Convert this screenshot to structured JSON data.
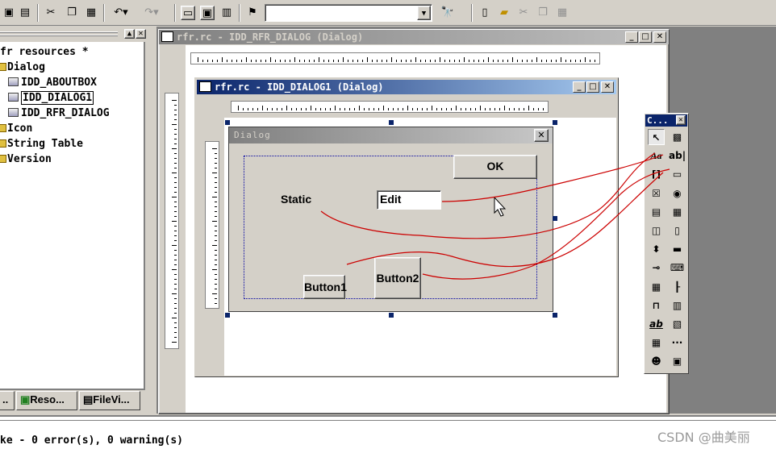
{
  "toolbar": {
    "icons": [
      "save-all-icon",
      "save-icon",
      "cut-icon",
      "copy-icon",
      "paste-icon",
      "undo-icon",
      "redo-icon",
      "workspace-icon",
      "output-icon",
      "window-list-icon",
      "find-in-files-icon",
      "find-icon"
    ],
    "combo_value": "",
    "right_icons": [
      "new-icon",
      "open-icon",
      "cut-icon",
      "copy-icon",
      "paste-icon"
    ]
  },
  "workspace": {
    "tree": [
      {
        "label": "fr resources *",
        "kind": "root"
      },
      {
        "label": "Dialog",
        "kind": "folder"
      },
      {
        "label": "IDD_ABOUTBOX",
        "kind": "item"
      },
      {
        "label": "IDD_DIALOG1",
        "kind": "item-selected"
      },
      {
        "label": "IDD_RFR_DIALOG",
        "kind": "item"
      },
      {
        "label": "Icon",
        "kind": "folder"
      },
      {
        "label": "String Table",
        "kind": "folder"
      },
      {
        "label": "Version",
        "kind": "folder"
      }
    ],
    "tabs": [
      "..",
      "Reso...",
      "FileVi..."
    ]
  },
  "window_back": {
    "title": "rfr.rc - IDD_RFR_DIALOG (Dialog)"
  },
  "window_front": {
    "title": "rfr.rc - IDD_DIALOG1 (Dialog)"
  },
  "dialog": {
    "title": "Dialog",
    "ok_label": "OK",
    "static_label": "Static",
    "edit_value": "Edit",
    "button1_label": "Button1",
    "button2_label": "Button2"
  },
  "palette": {
    "title": "C...",
    "tools": [
      "pointer",
      "picture",
      "static-text",
      "edit-box",
      "group-box",
      "button",
      "check-box",
      "radio-button",
      "combo-box",
      "list-box",
      "horizontal-scrollbar",
      "vertical-scrollbar",
      "spin",
      "progress",
      "slider",
      "hot-key",
      "list-control",
      "tree-control",
      "tab-control",
      "animate",
      "rich-edit",
      "date-time",
      "month-calendar",
      "ip-address",
      "custom-control",
      "extended-combo"
    ]
  },
  "output": {
    "text": "ke - 0 error(s), 0 warning(s)"
  },
  "watermark": "CSDN @曲美丽",
  "colors": {
    "active_title": "#0a246a",
    "annotation": "#cc0000",
    "face": "#d4d0c8"
  }
}
